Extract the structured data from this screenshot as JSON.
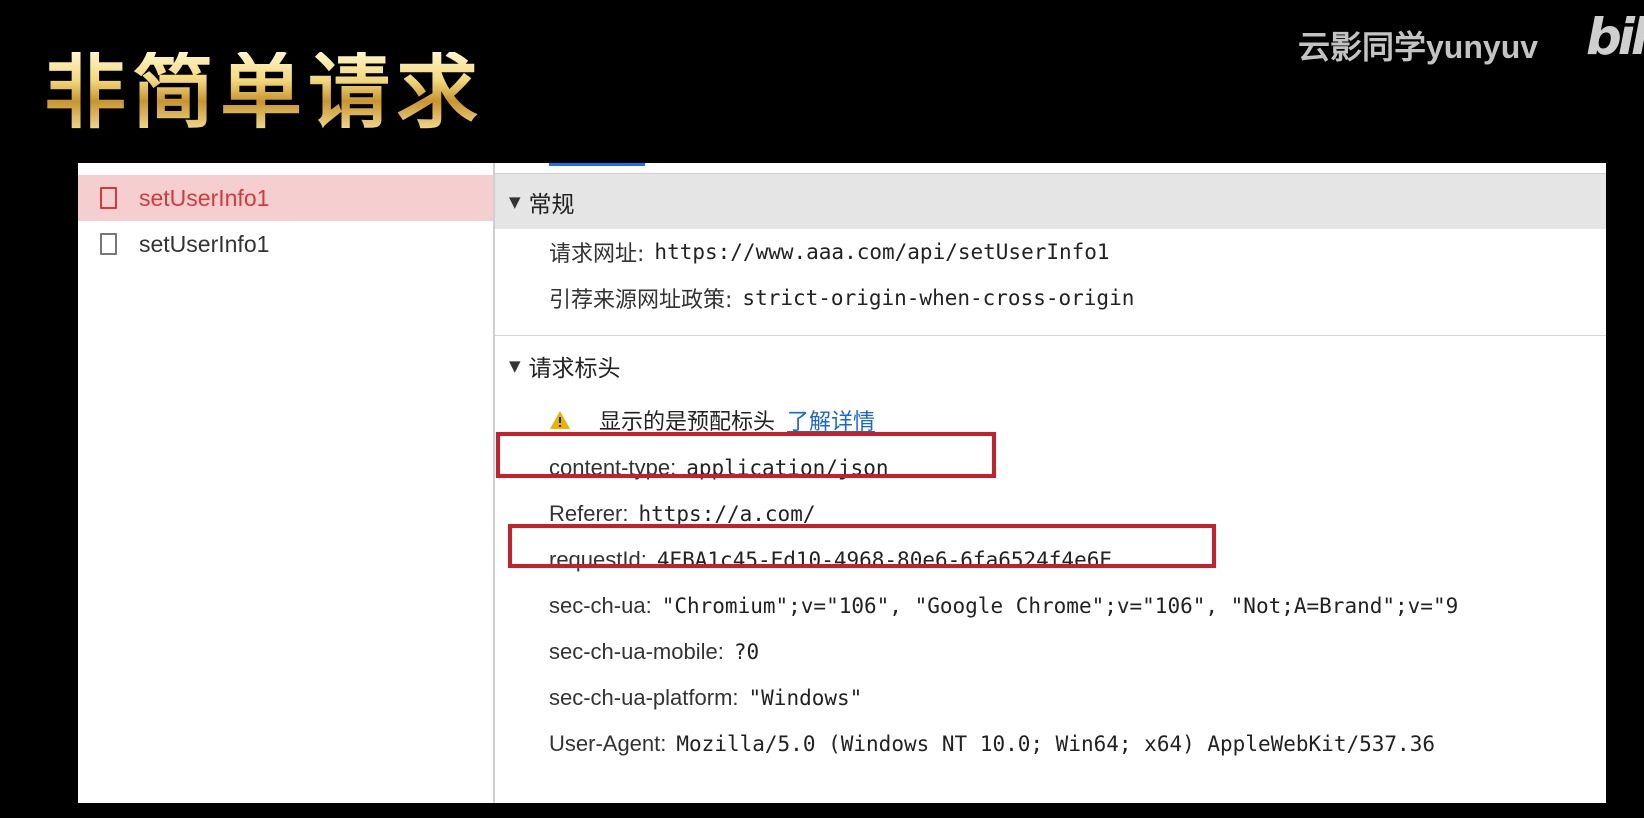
{
  "slide": {
    "title": "非简单请求",
    "watermark": "云影同学yunyuv",
    "logo": "bili"
  },
  "requests": [
    {
      "name": "setUserInfo1",
      "selected": true
    },
    {
      "name": "setUserInfo1",
      "selected": false
    }
  ],
  "general": {
    "title": "常规",
    "rows": [
      {
        "key": "请求网址:",
        "value": "https://www.aaa.com/api/setUserInfo1"
      },
      {
        "key": "引荐来源网址政策:",
        "value": "strict-origin-when-cross-origin"
      }
    ]
  },
  "request_headers": {
    "title": "请求标头",
    "warning": "显示的是预配标头",
    "learn_more": "了解详情",
    "rows": [
      {
        "key": "content-type:",
        "value": "application/json"
      },
      {
        "key": "Referer:",
        "value": "https://a.com/"
      },
      {
        "key": "requestId:",
        "value": "4EBA1c45-Ed10-4968-80e6-6fa6524f4e6E"
      },
      {
        "key": "sec-ch-ua:",
        "value": "\"Chromium\";v=\"106\", \"Google Chrome\";v=\"106\", \"Not;A=Brand\";v=\"9"
      },
      {
        "key": "sec-ch-ua-mobile:",
        "value": "?0"
      },
      {
        "key": "sec-ch-ua-platform:",
        "value": "\"Windows\""
      },
      {
        "key": "User-Agent:",
        "value": "Mozilla/5.0 (Windows NT 10.0; Win64; x64) AppleWebKit/537.36"
      }
    ]
  },
  "colors": {
    "highlight": "#c8202a",
    "selected_bg": "#f5cfd0",
    "selected_text": "#d33a3a",
    "link": "#1a66d8",
    "warning": "#e8b400"
  }
}
